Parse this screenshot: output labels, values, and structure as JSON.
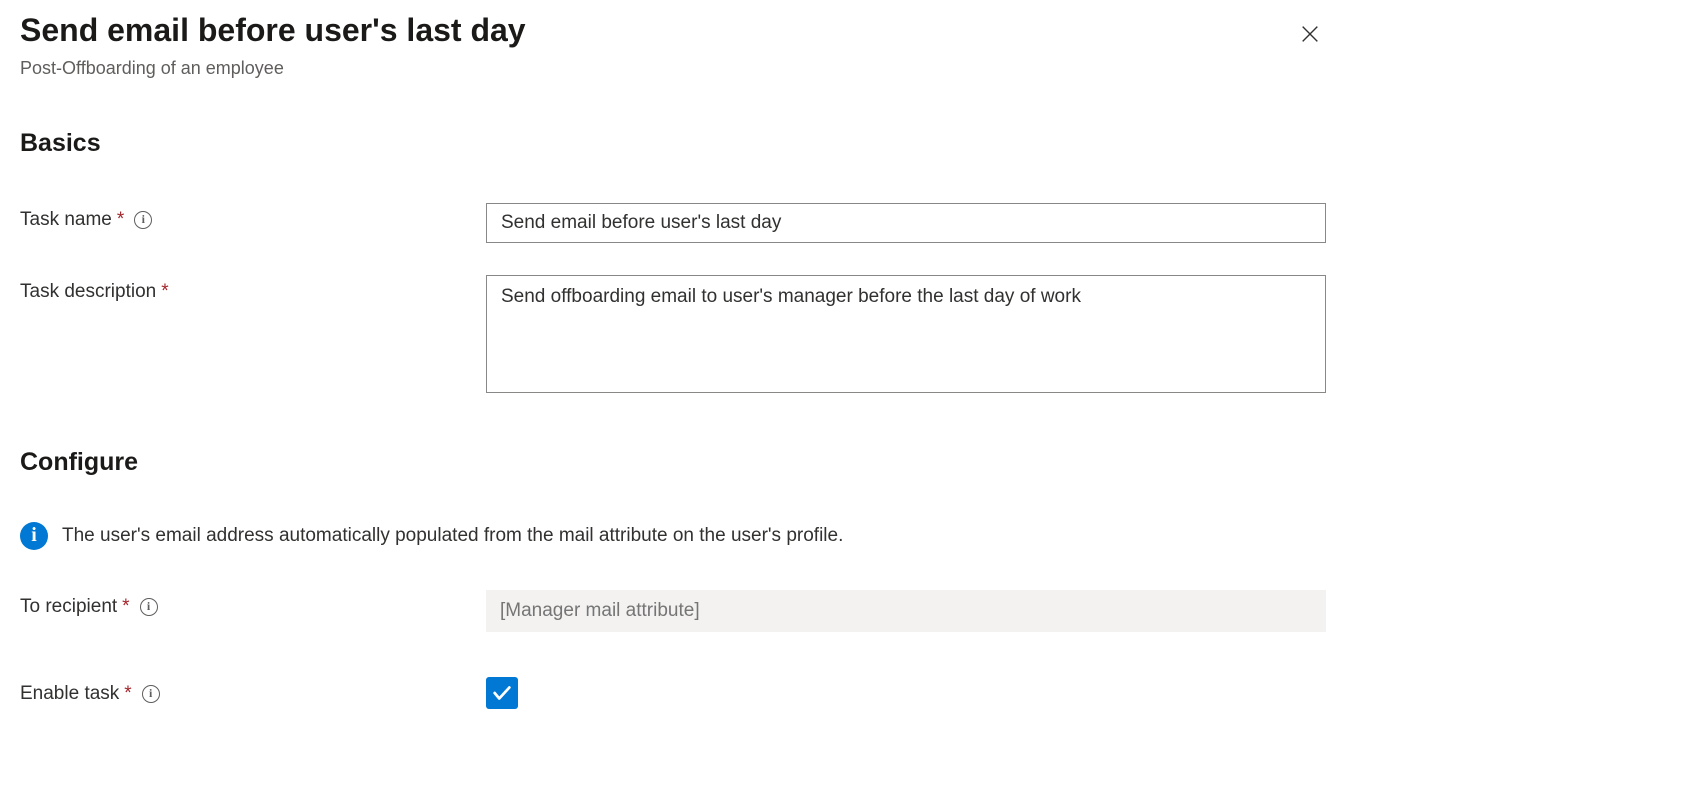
{
  "header": {
    "title": "Send email before user's last day",
    "subtitle": "Post-Offboarding of an employee"
  },
  "sections": {
    "basics_heading": "Basics",
    "configure_heading": "Configure"
  },
  "basics": {
    "task_name_label": "Task name",
    "task_name_value": "Send email before user's last day",
    "task_description_label": "Task description",
    "task_description_value": "Send offboarding email to user's manager before the last day of work"
  },
  "configure": {
    "info_message": "The user's email address automatically populated from the mail attribute on the user's profile.",
    "to_recipient_label": "To recipient",
    "to_recipient_placeholder": "[Manager mail attribute]",
    "enable_task_label": "Enable task",
    "enable_task_checked": true
  }
}
